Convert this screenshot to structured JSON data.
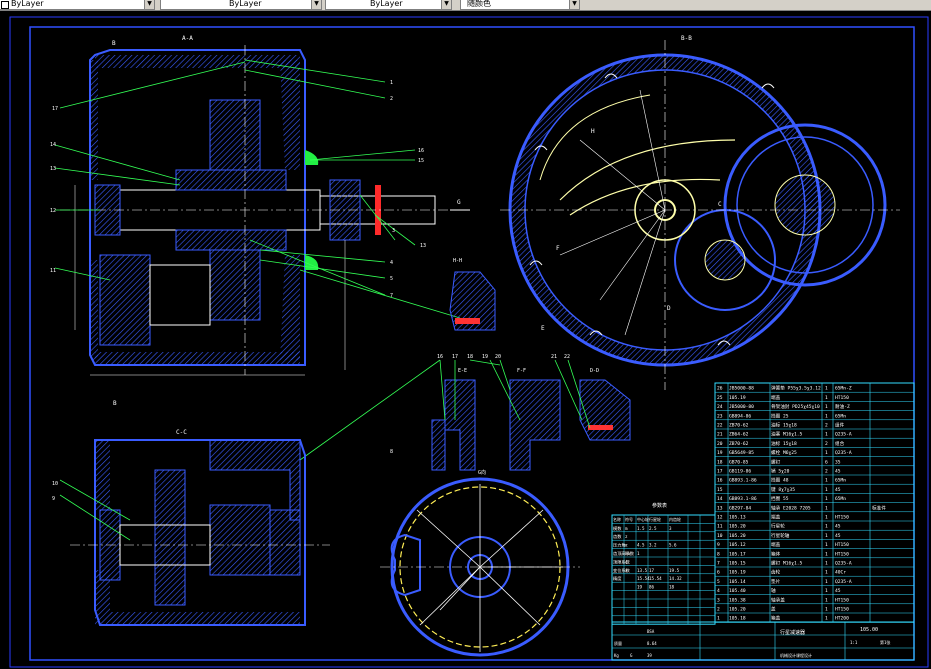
{
  "toolbar": {
    "linetype": "ByLayer",
    "lineweight": "ByLayer",
    "plotstyle": "ByLayer",
    "color_control": "随颜色"
  },
  "views": {
    "aa": "A-A",
    "bb": "B-B",
    "cc": "C-C",
    "hh": "H-H",
    "ee": "E-E",
    "ff": "F-F",
    "dd": "D-D",
    "g_arrow": "G",
    "g_view": "G向",
    "b_mark": "B",
    "b_mark2": "B",
    "c_mark": "C",
    "d_mark": "D",
    "e_mark": "E",
    "f_mark": "F",
    "h_mark": "H"
  },
  "callouts_top": [
    "1",
    "2",
    "3",
    "4",
    "5",
    "6",
    "7",
    "8",
    "9",
    "10",
    "11",
    "12",
    "13",
    "14",
    "15",
    "16",
    "17",
    "18",
    "19",
    "20",
    "21",
    "22",
    "23",
    "24"
  ],
  "callouts_mid": [
    "16",
    "17",
    "18",
    "19",
    "20",
    "21",
    "22"
  ],
  "dims_top": [
    "",
    "",
    ""
  ],
  "table_header": "技术要求",
  "bom_rows": [
    {
      "no": "26",
      "code": "JB5000-88",
      "name": "弹簧垫 P55χ3.5χ3.12",
      "qty": "1",
      "mat": "65Mn-Z"
    },
    {
      "no": "25",
      "code": "105.19",
      "name": "端盖",
      "qty": "1",
      "mat": "HT150"
    },
    {
      "no": "24",
      "code": "JB5000-80",
      "name": "骨架油封 PD25χ45χ10",
      "qty": "1",
      "mat": "耐油-Z"
    },
    {
      "no": "23",
      "code": "GB894-86",
      "name": "挡圈 25",
      "qty": "1",
      "mat": "65Mn"
    },
    {
      "no": "22",
      "code": "ZB70-62",
      "name": "油标 15χ18",
      "qty": "2",
      "mat": "组件"
    },
    {
      "no": "21",
      "code": "ZB64-62",
      "name": "油塞 M16χ1.5",
      "qty": "1",
      "mat": "Q235-A"
    },
    {
      "no": "20",
      "code": "ZB70-62",
      "name": "油标 15χ18",
      "qty": "2",
      "mat": "组合"
    },
    {
      "no": "19",
      "code": "GB5649-85",
      "name": "螺栓 M6χ25",
      "qty": "1",
      "mat": "Q235-A"
    },
    {
      "no": "18",
      "code": "GB70-85",
      "name": "螺钉",
      "qty": "6",
      "mat": "35"
    },
    {
      "no": "17",
      "code": "GB119-86",
      "name": "销 5χ20",
      "qty": "2",
      "mat": "45"
    },
    {
      "no": "16",
      "code": "GB893.1-86",
      "name": "挡圈 48",
      "qty": "1",
      "mat": "65Mn"
    },
    {
      "no": "15",
      "code": "",
      "name": "键 8χ7χ35",
      "qty": "1",
      "mat": "45"
    },
    {
      "no": "14",
      "code": "GB893.1-86",
      "name": "挡圈 55",
      "qty": "1",
      "mat": "65Mn"
    },
    {
      "no": "13",
      "code": "GB297-84",
      "name": "轴承 E2028 7205",
      "qty": "1",
      "mat": "",
      "extra": "标准件"
    },
    {
      "no": "12",
      "code": "105.13",
      "name": "端盖",
      "qty": "1",
      "mat": "HT150"
    },
    {
      "no": "11",
      "code": "105.20",
      "name": "行星轮",
      "qty": "1",
      "mat": "45"
    },
    {
      "no": "10",
      "code": "105.20",
      "name": "行星轮轴",
      "qty": "1",
      "mat": "45"
    },
    {
      "no": "9",
      "code": "105.12",
      "name": "端盖",
      "qty": "1",
      "mat": "HT150"
    },
    {
      "no": "8",
      "code": "105.17",
      "name": "箱体",
      "qty": "1",
      "mat": "HT150"
    },
    {
      "no": "7",
      "code": "105.15",
      "name": "螺钉 M16χ1.5",
      "qty": "1",
      "mat": "Q235-A"
    },
    {
      "no": "6",
      "code": "105.19",
      "name": "齿轮",
      "qty": "1",
      "mat": "40Cr"
    },
    {
      "no": "5",
      "code": "105.14",
      "name": "垫片",
      "qty": "1",
      "mat": "Q235-A"
    },
    {
      "no": "4",
      "code": "105.40",
      "name": "轴",
      "qty": "1",
      "mat": "45"
    },
    {
      "no": "3",
      "code": "105.38",
      "name": "轴承盖",
      "qty": "1",
      "mat": "HT150"
    },
    {
      "no": "2",
      "code": "105.20",
      "name": "盖",
      "qty": "1",
      "mat": "HT150"
    },
    {
      "no": "1",
      "code": "105.18",
      "name": "箱盖",
      "qty": "1",
      "mat": "HT200"
    }
  ],
  "bom_header": {
    "no": "序号",
    "code": "代号",
    "name": "名称",
    "qty": "数量",
    "mat": "材料"
  },
  "param_header": "参数表",
  "param_cols": [
    "名称",
    "符号",
    "中心轮",
    "行星轮",
    "内齿轮"
  ],
  "param_rows": [
    [
      "模数",
      "m",
      "1.5",
      "2.5",
      "3"
    ],
    [
      "齿数",
      "z",
      "",
      "",
      ""
    ],
    [
      "压力角",
      "α",
      "4.5",
      "3.2",
      "5.6"
    ],
    [
      "齿顶高系数",
      "ha",
      "1",
      "",
      ""
    ],
    [
      "顶隙系数",
      "c",
      "",
      "",
      ""
    ],
    [
      "变位系数",
      "x",
      "13.5",
      "17",
      "19.5"
    ],
    [
      "精度",
      "",
      "15.54",
      "15.54",
      "14.32"
    ],
    [
      "",
      "",
      "19",
      "86",
      "18"
    ],
    [
      "",
      "",
      "",
      "",
      ""
    ],
    [
      "",
      "",
      "",
      "",
      ""
    ],
    [
      "",
      "",
      "",
      "",
      ""
    ],
    [
      "",
      "",
      "",
      "",
      ""
    ]
  ],
  "title_block": {
    "drawing_no": "105.00",
    "title": "行星减速器",
    "scale": "1:1",
    "sheet": "第1张",
    "material": "BSA",
    "weight": "8.64",
    "units": "39",
    "company": "机械设计课程设计",
    "labels": [
      "标记",
      "处数",
      "分区",
      "更改文件号",
      "签名",
      "年月日",
      "设计",
      "审核",
      "工艺",
      "批准",
      "阶段标记",
      "重量",
      "比例"
    ],
    "mass_label": "质量",
    "g_label": "G",
    "kg_label": "Kg"
  }
}
